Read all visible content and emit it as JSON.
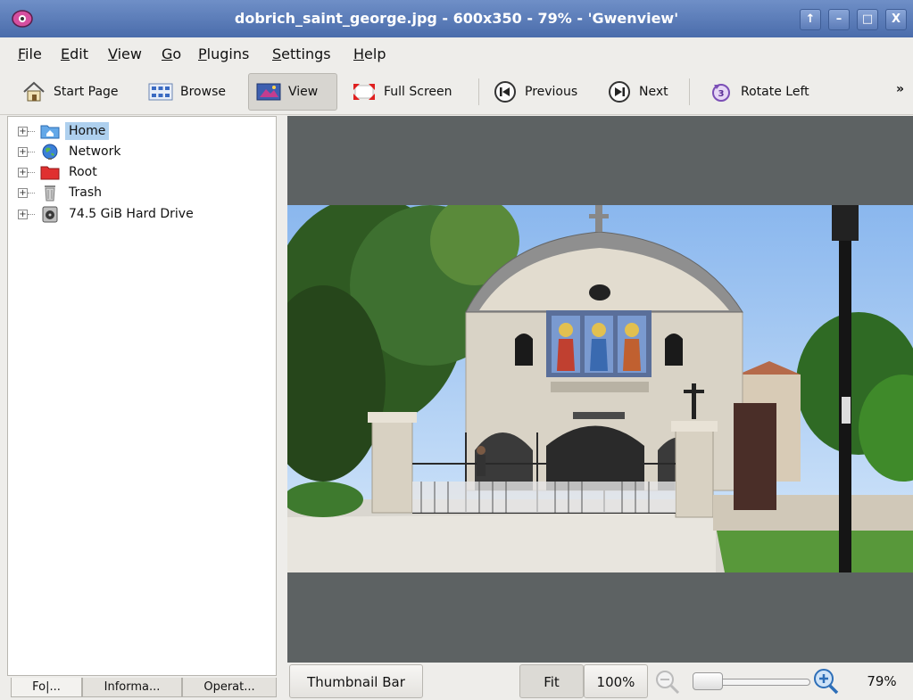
{
  "window": {
    "title": "dobrich_saint_george.jpg - 600x350 - 79% - 'Gwenview'",
    "buttons": {
      "keep_above": "↑",
      "minimize": "–",
      "maximize": "□",
      "close": "X"
    }
  },
  "menubar": {
    "items": [
      {
        "label": "File",
        "mnemonic": "F",
        "rest": "ile"
      },
      {
        "label": "Edit",
        "mnemonic": "E",
        "rest": "dit"
      },
      {
        "label": "View",
        "mnemonic": "V",
        "rest": "iew"
      },
      {
        "label": "Go",
        "mnemonic": "G",
        "rest": "o"
      },
      {
        "label": "Plugins",
        "mnemonic": "P",
        "rest": "lugins"
      },
      {
        "label": "Settings",
        "mnemonic": "S",
        "rest": "ettings"
      },
      {
        "label": "Help",
        "mnemonic": "H",
        "rest": "elp"
      }
    ]
  },
  "toolbar": {
    "start_page": "Start Page",
    "browse": "Browse",
    "view": "View",
    "full_screen": "Full Screen",
    "previous": "Previous",
    "next": "Next",
    "rotate_left": "Rotate Left",
    "overflow": "»"
  },
  "sidebar": {
    "tree": [
      {
        "label": "Home",
        "icon": "home-folder-icon",
        "selected": true
      },
      {
        "label": "Network",
        "icon": "network-globe-icon"
      },
      {
        "label": "Root",
        "icon": "root-folder-icon"
      },
      {
        "label": "Trash",
        "icon": "trash-icon"
      },
      {
        "label": "74.5 GiB Hard Drive",
        "icon": "hard-drive-icon"
      }
    ],
    "tabs": [
      {
        "label": "Fo|...",
        "active": true
      },
      {
        "label": "Informa...",
        "active": false
      },
      {
        "label": "Operat...",
        "active": false
      }
    ]
  },
  "statusbar": {
    "thumbnail_bar": "Thumbnail Bar",
    "fit": "Fit",
    "hundred": "100%",
    "zoom": "79%"
  },
  "colors": {
    "titlebar": "#5676b4",
    "viewer_bg": "#5d6263",
    "selection": "#aed0ee"
  }
}
